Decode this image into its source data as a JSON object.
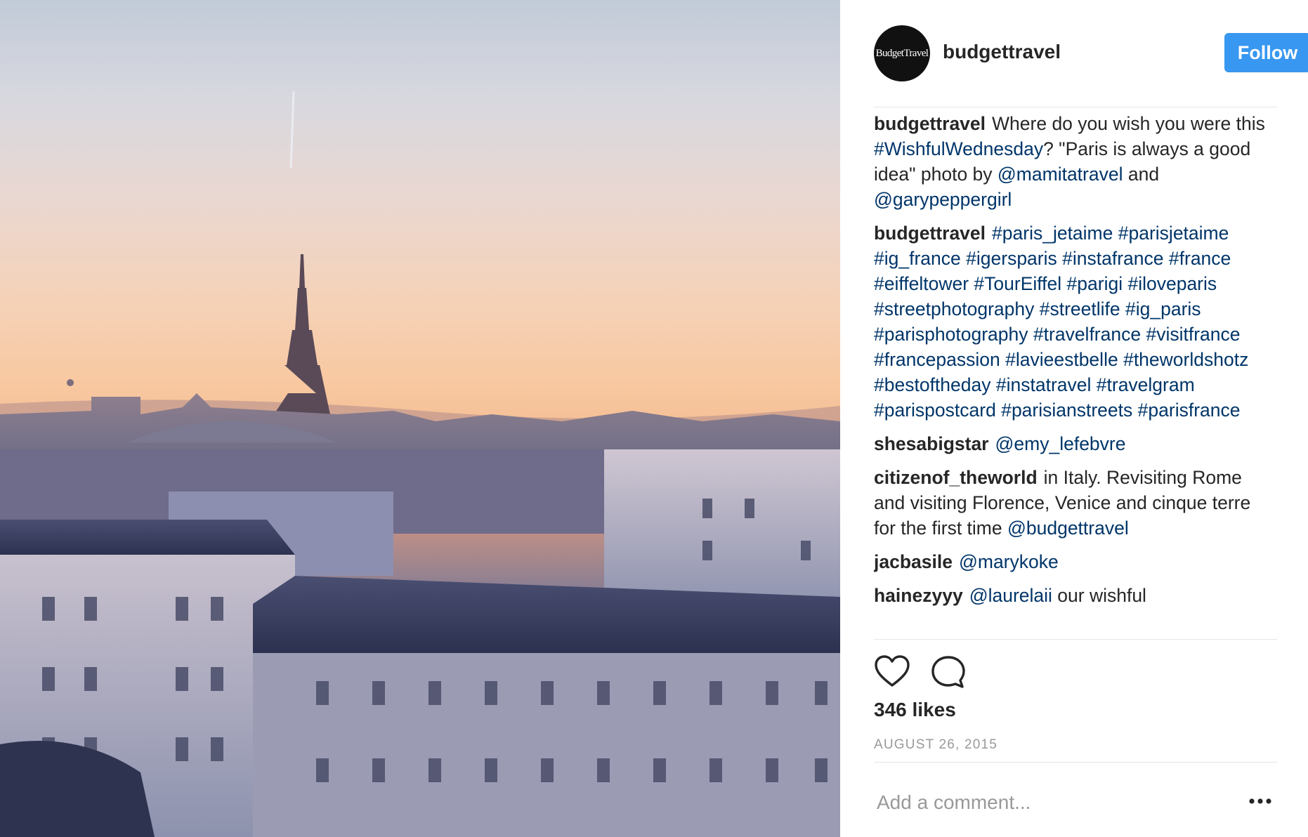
{
  "post": {
    "photo_subject": "paris-skyline-eiffel-tower"
  },
  "header": {
    "avatar_text": "BudgetTravel",
    "username": "budgettravel",
    "follow_label": "Follow",
    "follow_color": "#3897f0"
  },
  "comments": [
    {
      "author": "budgettravel",
      "segments": [
        {
          "text": "Where do you wish you were this ",
          "link": false
        },
        {
          "text": "#WishfulWednesday",
          "link": true
        },
        {
          "text": "? \"Paris is always a good idea\" photo by ",
          "link": false
        },
        {
          "text": "@mamitatravel",
          "link": true
        },
        {
          "text": " and ",
          "link": false
        },
        {
          "text": "@garypeppergirl",
          "link": true
        }
      ]
    },
    {
      "author": "budgettravel",
      "segments": [
        {
          "text": "#paris_jetaime",
          "link": true
        },
        {
          "text": " ",
          "link": false
        },
        {
          "text": "#parisjetaime",
          "link": true
        },
        {
          "text": " ",
          "link": false
        },
        {
          "text": "#ig_france",
          "link": true
        },
        {
          "text": " ",
          "link": false
        },
        {
          "text": "#igersparis",
          "link": true
        },
        {
          "text": " ",
          "link": false
        },
        {
          "text": "#instafrance",
          "link": true
        },
        {
          "text": " ",
          "link": false
        },
        {
          "text": "#france",
          "link": true
        },
        {
          "text": " ",
          "link": false
        },
        {
          "text": "#eiffeltower",
          "link": true
        },
        {
          "text": " ",
          "link": false
        },
        {
          "text": "#TourEiffel",
          "link": true
        },
        {
          "text": " ",
          "link": false
        },
        {
          "text": "#parigi",
          "link": true
        },
        {
          "text": " ",
          "link": false
        },
        {
          "text": "#iloveparis",
          "link": true
        },
        {
          "text": " ",
          "link": false
        },
        {
          "text": "#streetphotography",
          "link": true
        },
        {
          "text": " ",
          "link": false
        },
        {
          "text": "#streetlife",
          "link": true
        },
        {
          "text": " ",
          "link": false
        },
        {
          "text": "#ig_paris",
          "link": true
        },
        {
          "text": " ",
          "link": false
        },
        {
          "text": "#parisphotography",
          "link": true
        },
        {
          "text": " ",
          "link": false
        },
        {
          "text": "#travelfrance",
          "link": true
        },
        {
          "text": " ",
          "link": false
        },
        {
          "text": "#visitfrance",
          "link": true
        },
        {
          "text": " ",
          "link": false
        },
        {
          "text": "#francepassion",
          "link": true
        },
        {
          "text": " ",
          "link": false
        },
        {
          "text": "#lavieestbelle",
          "link": true
        },
        {
          "text": " ",
          "link": false
        },
        {
          "text": "#theworldshotz",
          "link": true
        },
        {
          "text": " ",
          "link": false
        },
        {
          "text": "#bestoftheday",
          "link": true
        },
        {
          "text": " ",
          "link": false
        },
        {
          "text": "#instatravel",
          "link": true
        },
        {
          "text": " ",
          "link": false
        },
        {
          "text": "#travelgram",
          "link": true
        },
        {
          "text": " ",
          "link": false
        },
        {
          "text": "#parispostcard",
          "link": true
        },
        {
          "text": " ",
          "link": false
        },
        {
          "text": "#parisianstreets",
          "link": true
        },
        {
          "text": " ",
          "link": false
        },
        {
          "text": "#parisfrance",
          "link": true
        }
      ]
    },
    {
      "author": "shesabigstar",
      "segments": [
        {
          "text": "@emy_lefebvre",
          "link": true
        }
      ]
    },
    {
      "author": "citizenof_theworld",
      "segments": [
        {
          "text": "in Italy. Revisiting Rome and visiting Florence, Venice and cinque terre for the first time ",
          "link": false
        },
        {
          "text": "@budgettravel",
          "link": true
        }
      ]
    },
    {
      "author": "jacbasile",
      "segments": [
        {
          "text": "@marykoke",
          "link": true
        }
      ]
    },
    {
      "author": "hainezyyy",
      "segments": [
        {
          "text": "@laurelaii",
          "link": true
        },
        {
          "text": " our wishful",
          "link": false
        }
      ]
    }
  ],
  "actions": {
    "like_icon": "heart-outline-icon",
    "comment_icon": "speech-bubble-icon"
  },
  "likes_label": "346 likes",
  "date_label": "AUGUST 26, 2015",
  "comment_input": {
    "placeholder": "Add a comment...",
    "value": ""
  },
  "more_icon": "ellipsis-icon",
  "link_color": "#003569"
}
